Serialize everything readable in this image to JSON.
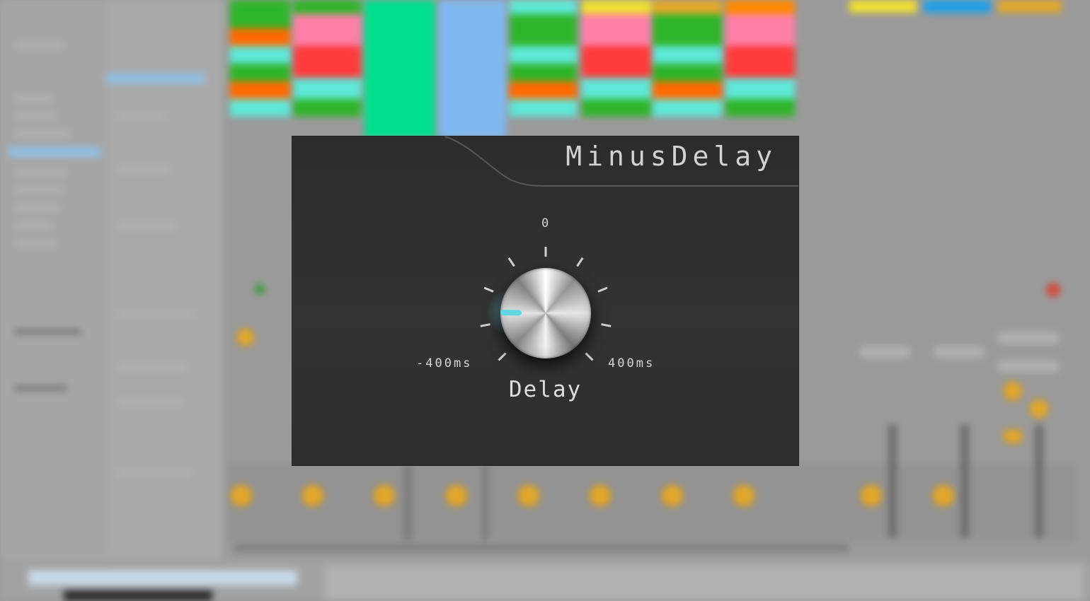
{
  "plugin": {
    "title": "MinusDelay",
    "parameter": {
      "label": "Delay",
      "min_label": "-400ms",
      "max_label": "400ms",
      "center_label": "0",
      "value_fraction": 0.17,
      "indicator_color": "#5fd6e0"
    }
  },
  "background": {
    "clip_colors": [
      "#2fb52a",
      "#ff6a00",
      "#5ee8d8",
      "#ff3a3a",
      "#ff7fa8",
      "#00e08c",
      "#7fb8f0",
      "#f0e030",
      "#1ea0e8",
      "#e2a72a"
    ],
    "fader_knob_color": "#e2a72a"
  }
}
